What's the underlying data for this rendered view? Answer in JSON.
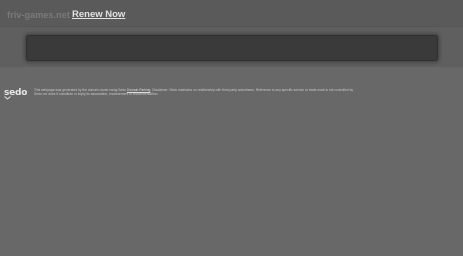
{
  "header": {
    "domain": "friv-games.net",
    "renew_label": "Renew Now"
  },
  "footer": {
    "logo_text": "sedo",
    "disclaimer_part1": "This webpage was generated by the domain owner using Sedo ",
    "disclaimer_link": "Domain Parking",
    "disclaimer_part2": ". Disclaimer: Sedo maintains no relationship with third party advertisers. Reference to any specific service or trade mark is not controlled by Sedo nor does it constitute or imply its association, endorsement or recommendation."
  },
  "colors": {
    "background": "#686868",
    "ad_box": "#3a3a3a",
    "renew_link": "#e2e2e2"
  }
}
